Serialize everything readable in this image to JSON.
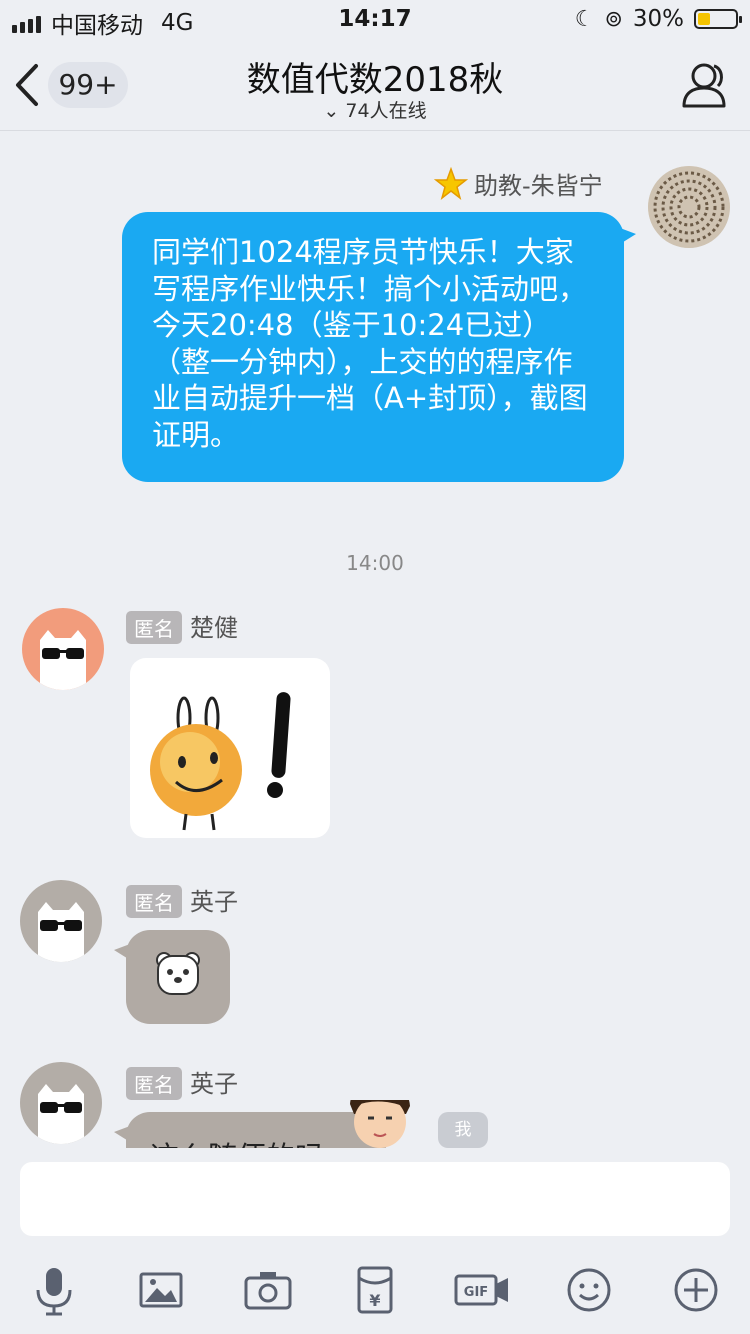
{
  "status_bar": {
    "carrier": "中国移动",
    "network": "4G",
    "time": "14:17",
    "battery_percent": "30%",
    "battery_level": 0.3
  },
  "nav": {
    "back_label": "<",
    "unread_count": "99+",
    "title": "数值代数2018秋",
    "online_count": "74人在线"
  },
  "messages": {
    "ta_name": "助教-朱皆宁",
    "ta_text": "同学们1024程序员节快乐！大家写程序作业快乐！搞个小活动吧，今天20:48（鉴于10:24已过）（整一分钟内），上交的的程序作业自动提升一档（A+封顶），截图证明。",
    "divider_time": "14:00",
    "anon_label": "匿名",
    "msg1_name": "楚健",
    "msg2_name": "英子",
    "msg3_name": "英子",
    "msg3_text_partial": "这么随便的吗",
    "me_label": "我"
  },
  "colors": {
    "bubble_blue": "#1aa9f2",
    "bubble_gray": "#b1aaa4",
    "background": "#edeff3"
  }
}
